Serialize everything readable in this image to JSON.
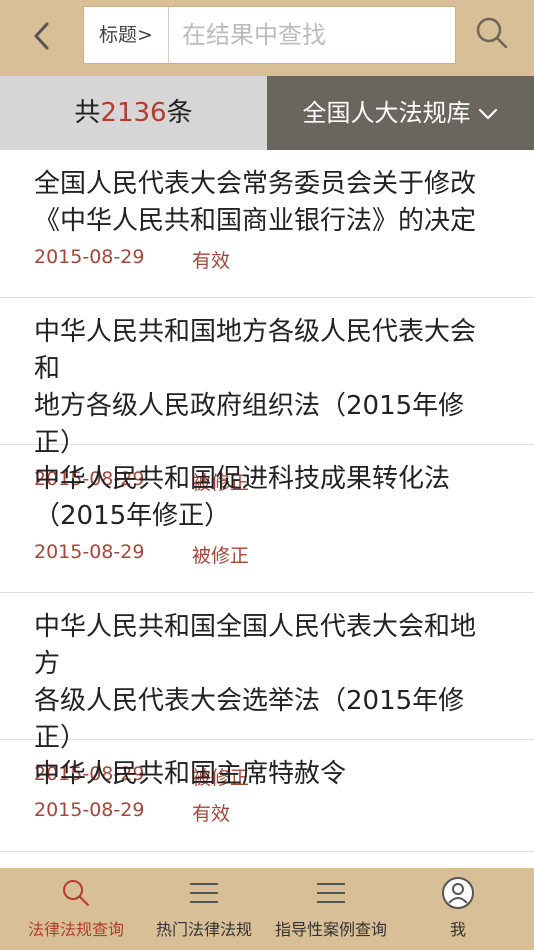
{
  "header": {
    "back_icon": "chevron-left-icon",
    "search_scope": "标题>",
    "search_placeholder": "在结果中查找",
    "search_icon": "search-icon"
  },
  "filter": {
    "count_prefix": "共",
    "count_value": "2136",
    "count_suffix": "条",
    "library": "全国人大法规库",
    "library_icon": "chevron-down-icon"
  },
  "results": [
    {
      "title_line1": "全国人民代表大会常务委员会关于修改",
      "title_line2": "《中华人民共和国商业银行法》的决定",
      "date": "2015-08-29",
      "status": "有效"
    },
    {
      "title_line1": "中华人民共和国地方各级人民代表大会和",
      "title_line2": "地方各级人民政府组织法（2015年修正）",
      "date": "2015-08-29",
      "status": "被修正"
    },
    {
      "title_line1": "中华人民共和国促进科技成果转化法",
      "title_line2": "（2015年修正）",
      "date": "2015-08-29",
      "status": "被修正"
    },
    {
      "title_line1": "中华人民共和国全国人民代表大会和地方",
      "title_line2": "各级人民代表大会选举法（2015年修正）",
      "date": "2015-08-29",
      "status": "被修正"
    },
    {
      "title_line1": "中华人民共和国主席特赦令",
      "title_line2": "",
      "date": "2015-08-29",
      "status": "有效"
    }
  ],
  "nav": {
    "tabs": [
      {
        "label": "法律法规查询",
        "icon": "search-icon"
      },
      {
        "label": "热门法律法规",
        "icon": "menu-icon"
      },
      {
        "label": "指导性案例查询",
        "icon": "menu-icon"
      },
      {
        "label": "我",
        "icon": "user-icon"
      }
    ]
  },
  "colors": {
    "header_bg": "#d8bf98",
    "accent_red": "#b53b2f",
    "library_bg": "#6a655d"
  }
}
